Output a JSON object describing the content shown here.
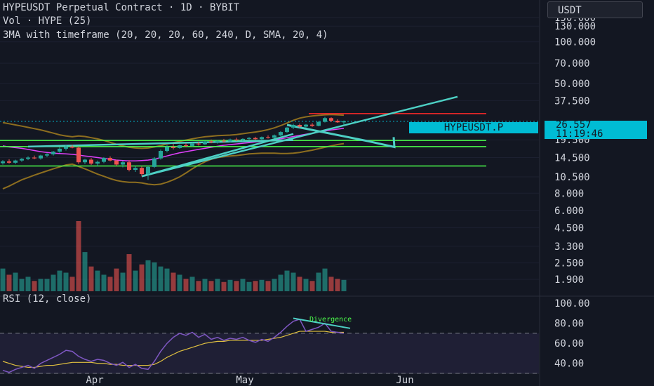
{
  "header": {
    "title": "HYPEUSDT Perpetual Contract · 1D · BYBIT",
    "volume": "Vol · HYPE (25)",
    "indicator": "3MA with timeframe (20, 20, 20, 60, 240, D, SMA, 20, 4)"
  },
  "currency": "USDT",
  "ticker_tag": "HYPEUSDT.P",
  "last_price": "26.557",
  "countdown": "11:19:46",
  "rsi": {
    "label": "RSI (12, close)",
    "annotation": "Divergence"
  },
  "colors": {
    "background": "#131722",
    "up": "#26a69a",
    "down": "#ef5350",
    "trendline": "#4dd0c4",
    "support": "#4cff4c",
    "resistance": "#ff2a2a",
    "bollinger": "#8d6e1f",
    "rsi_line": "#7e57c2",
    "rsi_ma": "#e0c040",
    "price_tag": "#00bcd4"
  },
  "chart_data": [
    {
      "type": "candlestick",
      "title": "HYPEUSDT Perpetual Contract · 1D · BYBIT",
      "y_scale": "log",
      "y_ticks": [
        "150.000",
        "130.000",
        "100.000",
        "70.000",
        "50.000",
        "37.500",
        "26.557",
        "19.500",
        "14.500",
        "10.500",
        "8.000",
        "6.000",
        "4.500",
        "3.300",
        "2.500",
        "1.900"
      ],
      "x_ticks": [
        "Apr",
        "May",
        "Jun"
      ],
      "ohlc": [
        [
          13.2,
          13.9,
          12.9,
          13.6
        ],
        [
          13.6,
          14.1,
          13.1,
          13.3
        ],
        [
          13.3,
          14.0,
          13.0,
          13.8
        ],
        [
          13.8,
          14.4,
          13.5,
          14.2
        ],
        [
          14.2,
          14.8,
          13.9,
          14.5
        ],
        [
          14.5,
          15.0,
          14.1,
          14.3
        ],
        [
          14.3,
          15.2,
          14.0,
          15.0
        ],
        [
          15.0,
          15.6,
          14.6,
          15.3
        ],
        [
          15.3,
          16.2,
          15.0,
          16.0
        ],
        [
          16.0,
          17.2,
          15.7,
          16.8
        ],
        [
          16.8,
          17.8,
          16.3,
          17.4
        ],
        [
          17.4,
          17.9,
          16.9,
          17.1
        ],
        [
          17.1,
          17.5,
          13.0,
          13.4
        ],
        [
          13.4,
          14.2,
          13.0,
          14.0
        ],
        [
          14.0,
          14.4,
          12.8,
          13.1
        ],
        [
          13.1,
          13.8,
          12.5,
          13.5
        ],
        [
          13.5,
          14.6,
          13.2,
          14.4
        ],
        [
          14.4,
          14.8,
          13.6,
          13.8
        ],
        [
          13.8,
          14.0,
          12.6,
          12.9
        ],
        [
          12.9,
          13.7,
          12.3,
          13.4
        ],
        [
          13.4,
          13.9,
          11.5,
          11.8
        ],
        [
          11.8,
          12.6,
          11.4,
          12.2
        ],
        [
          12.2,
          12.5,
          10.6,
          11.0
        ],
        [
          11.0,
          12.7,
          10.0,
          12.4
        ],
        [
          12.4,
          14.6,
          12.2,
          14.3
        ],
        [
          14.3,
          16.6,
          14.0,
          16.2
        ],
        [
          16.2,
          17.8,
          15.8,
          17.3
        ],
        [
          17.3,
          18.2,
          16.6,
          17.0
        ],
        [
          17.0,
          18.0,
          16.8,
          17.8
        ],
        [
          17.8,
          18.4,
          17.2,
          17.6
        ],
        [
          17.6,
          18.6,
          17.3,
          18.3
        ],
        [
          18.3,
          18.9,
          17.7,
          18.1
        ],
        [
          18.1,
          19.2,
          17.9,
          19.0
        ],
        [
          19.0,
          19.6,
          18.4,
          18.7
        ],
        [
          18.7,
          19.4,
          18.3,
          19.2
        ],
        [
          19.2,
          19.8,
          18.6,
          19.0
        ],
        [
          19.0,
          19.9,
          18.7,
          19.6
        ],
        [
          19.6,
          20.2,
          19.1,
          19.4
        ],
        [
          19.4,
          20.0,
          19.0,
          19.8
        ],
        [
          19.8,
          20.4,
          19.3,
          20.1
        ],
        [
          20.1,
          20.5,
          19.5,
          19.7
        ],
        [
          19.7,
          20.6,
          19.4,
          20.4
        ],
        [
          20.4,
          21.0,
          19.9,
          20.2
        ],
        [
          20.2,
          21.3,
          20.0,
          21.0
        ],
        [
          21.0,
          22.5,
          20.7,
          22.2
        ],
        [
          22.2,
          24.2,
          21.9,
          23.9
        ],
        [
          23.9,
          25.5,
          23.3,
          25.0
        ],
        [
          25.0,
          25.6,
          23.8,
          24.3
        ],
        [
          24.3,
          25.4,
          23.9,
          25.1
        ],
        [
          25.1,
          25.8,
          24.2,
          24.6
        ],
        [
          24.6,
          26.6,
          24.4,
          26.3
        ],
        [
          26.3,
          28.6,
          26.0,
          28.0
        ],
        [
          28.0,
          28.4,
          26.2,
          26.8
        ],
        [
          26.8,
          27.5,
          25.9,
          26.1
        ],
        [
          26.1,
          26.9,
          24.9,
          26.557
        ]
      ],
      "volume": [
        110,
        80,
        90,
        60,
        70,
        50,
        60,
        60,
        80,
        100,
        90,
        70,
        340,
        190,
        120,
        100,
        80,
        70,
        110,
        90,
        180,
        100,
        130,
        150,
        140,
        120,
        110,
        90,
        80,
        60,
        70,
        50,
        60,
        50,
        60,
        45,
        55,
        50,
        60,
        45,
        50,
        55,
        50,
        60,
        80,
        100,
        90,
        70,
        60,
        50,
        90,
        110,
        70,
        60,
        55
      ],
      "bollinger": {
        "upper": [
          26.0,
          25.5,
          25.0,
          24.5,
          24.0,
          23.5,
          23.0,
          22.4,
          21.8,
          21.2,
          20.8,
          20.5,
          20.8,
          20.6,
          20.2,
          19.8,
          19.3,
          18.7,
          18.1,
          17.6,
          17.2,
          17.0,
          16.9,
          17.0,
          17.3,
          17.7,
          18.2,
          18.6,
          19.0,
          19.4,
          19.8,
          20.2,
          20.5,
          20.7,
          20.9,
          21.0,
          21.1,
          21.3,
          21.6,
          21.9,
          22.2,
          22.6,
          23.1,
          23.8,
          24.7,
          25.8,
          27.0,
          28.0,
          28.6,
          29.0,
          29.3,
          29.6,
          29.7,
          29.6,
          29.4
        ],
        "lower": [
          8.6,
          9.0,
          9.5,
          10.0,
          10.4,
          10.8,
          11.2,
          11.6,
          12.0,
          12.4,
          12.8,
          13.0,
          12.5,
          12.0,
          11.5,
          11.0,
          10.6,
          10.2,
          9.9,
          9.7,
          9.6,
          9.6,
          9.5,
          9.3,
          9.2,
          9.3,
          9.6,
          10.0,
          10.5,
          11.2,
          12.0,
          12.8,
          13.5,
          14.1,
          14.5,
          14.7,
          14.9,
          15.0,
          15.2,
          15.4,
          15.5,
          15.6,
          15.6,
          15.6,
          15.5,
          15.5,
          15.6,
          15.8,
          16.1,
          16.4,
          16.8,
          17.2,
          17.6,
          18.0,
          18.3
        ]
      },
      "ma_band": [
        17.6,
        17.3,
        17.1,
        16.9,
        16.6,
        16.3,
        16.0,
        15.8,
        15.6,
        15.5,
        15.4,
        15.3,
        15.1,
        14.9,
        14.7,
        14.5,
        14.3,
        14.1,
        13.9,
        13.8,
        13.7,
        13.7,
        13.8,
        13.9,
        14.1,
        14.5,
        14.9,
        15.3,
        15.7,
        16.0,
        16.3,
        16.6,
        16.9,
        17.2,
        17.5,
        17.8,
        18.0,
        18.2,
        18.4,
        18.6,
        18.8,
        19.0,
        19.2,
        19.5,
        19.8,
        20.2,
        20.6,
        21.0,
        21.4,
        21.8,
        22.2,
        22.6,
        23.0,
        23.3,
        23.6
      ],
      "support_levels": [
        19.3,
        17.4,
        12.6
      ],
      "resistance_level": 30.2,
      "trendlines": [
        {
          "from": [
            22,
            10.6
          ],
          "to": [
            72,
            40.0
          ]
        },
        {
          "from": [
            22,
            10.6
          ],
          "to": [
            46,
            21.5
          ]
        },
        {
          "from": [
            4,
            17.4
          ],
          "to": [
            46,
            19.4
          ]
        }
      ],
      "projection": {
        "from": [
          45,
          25.0
        ],
        "mid": [
          58,
          19.0
        ],
        "to": [
          62,
          17.3
        ]
      }
    },
    {
      "type": "line",
      "title": "RSI (12, close)",
      "y_ticks": [
        "100.00",
        "80.00",
        "60.00",
        "40.00"
      ],
      "ylim": [
        30,
        105
      ],
      "levels": [
        70,
        30
      ],
      "rsi": [
        33,
        31,
        34,
        36,
        38,
        35,
        40,
        43,
        46,
        49,
        53,
        52,
        47,
        44,
        42,
        44,
        43,
        40,
        38,
        41,
        36,
        39,
        35,
        34,
        42,
        52,
        60,
        66,
        70,
        68,
        71,
        66,
        69,
        64,
        66,
        63,
        65,
        64,
        66,
        63,
        61,
        64,
        62,
        66,
        71,
        77,
        82,
        84,
        72,
        74,
        76,
        80,
        72,
        71,
        70
      ],
      "rsi_ma": [
        42,
        40,
        38,
        37,
        36,
        36,
        37,
        38,
        38,
        39,
        40,
        41,
        41,
        41,
        41,
        40,
        40,
        39,
        39,
        38,
        38,
        38,
        38,
        38,
        39,
        42,
        46,
        49,
        52,
        54,
        56,
        58,
        60,
        61,
        62,
        62,
        63,
        63,
        63,
        63,
        63,
        63,
        64,
        65,
        66,
        68,
        70,
        72,
        72,
        72,
        72,
        72,
        71,
        71,
        71
      ],
      "divergence_line": {
        "from": [
          46,
          85
        ],
        "to": [
          55,
          75
        ]
      }
    }
  ]
}
